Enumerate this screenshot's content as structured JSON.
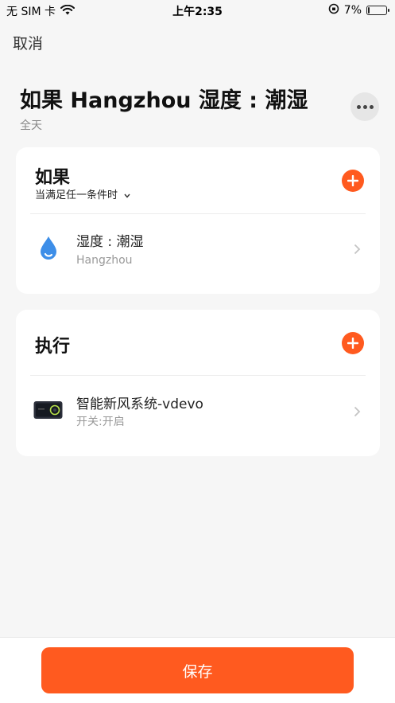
{
  "status_bar": {
    "carrier": "无 SIM 卡",
    "time": "上午2:35",
    "battery_text": "7%",
    "battery_level": 0.07
  },
  "header": {
    "cancel_label": "取消",
    "title": "如果 Hangzhou 湿度 : 潮湿",
    "subtitle": "全天"
  },
  "if_card": {
    "title": "如果",
    "condition_mode": "当满足任一条件时",
    "items": [
      {
        "title": "湿度 : 潮湿",
        "subtitle": "Hangzhou",
        "icon": "water-drop-icon"
      }
    ]
  },
  "do_card": {
    "title": "执行",
    "items": [
      {
        "title": "智能新风系统-vdevo",
        "subtitle": "开关:开启",
        "icon": "device-icon"
      }
    ]
  },
  "footer": {
    "save_label": "保存"
  },
  "colors": {
    "accent": "#ff5a1f",
    "background": "#f6f6f6",
    "card": "#ffffff"
  }
}
